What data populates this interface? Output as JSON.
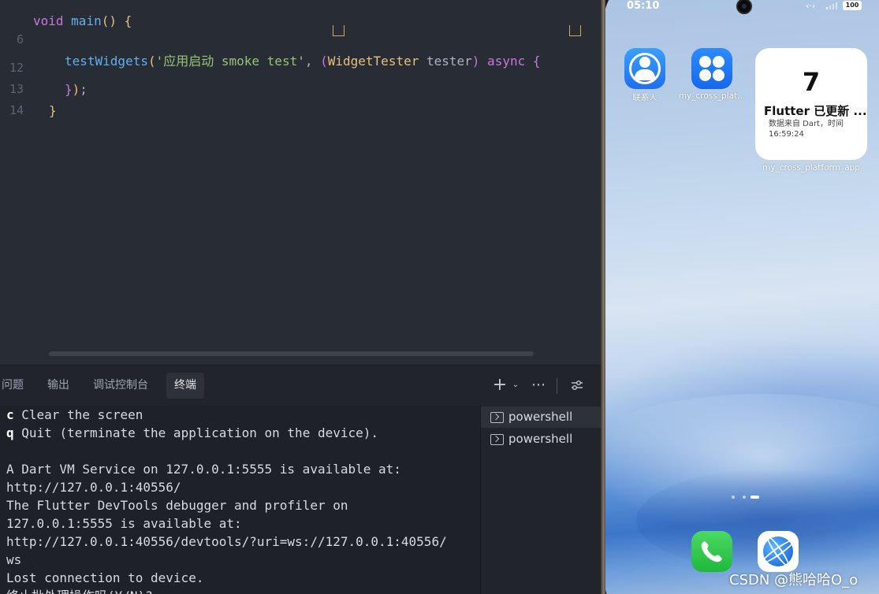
{
  "editor": {
    "line_numbers": [
      "6",
      "12",
      "13",
      "14"
    ],
    "line6": {
      "fn": "testWidgets",
      "open": "(",
      "str": "'应用启动 smoke test'",
      "comma": ", ",
      "paren2": "(",
      "type": "WidgetTester",
      "param": " tester",
      "paren2_close": ")",
      "async": " async",
      "brace": " {"
    },
    "line12": {
      "brace": "}",
      "paren": ")",
      "semi": ";"
    },
    "line13": {
      "brace": "}"
    }
  },
  "panel": {
    "tabs": [
      {
        "label": "问题"
      },
      {
        "label": "输出"
      },
      {
        "label": "调试控制台"
      },
      {
        "label": "终端",
        "active": true
      }
    ],
    "toolbar_icons": [
      "plus-icon",
      "chevron-down-icon",
      "more-icon",
      "settings-sliders-icon"
    ]
  },
  "terminal": {
    "lines": [
      {
        "key": "c",
        "text": " Clear the screen"
      },
      {
        "key": "q",
        "text": " Quit (terminate the application on the device)."
      },
      {
        "key": "",
        "text": ""
      },
      {
        "key": "",
        "text": "A Dart VM Service on 127.0.0.1:5555 is available at:"
      },
      {
        "key": "",
        "text": "http://127.0.0.1:40556/"
      },
      {
        "key": "",
        "text": "The Flutter DevTools debugger and profiler on"
      },
      {
        "key": "",
        "text": "127.0.0.1:5555 is available at:"
      },
      {
        "key": "",
        "text": "http://127.0.0.1:40556/devtools/?uri=ws://127.0.0.1:40556/"
      },
      {
        "key": "",
        "text": "ws"
      },
      {
        "key": "",
        "text": "Lost connection to device."
      },
      {
        "key": "",
        "text": "终止批处理操作吗(Y/N)?"
      }
    ],
    "instances": [
      {
        "label": "powershell",
        "selected": true
      },
      {
        "label": "powershell",
        "selected": false
      }
    ]
  },
  "phone": {
    "time": "05:10",
    "battery": "100",
    "apps": {
      "contacts": "联系人",
      "cross_platform": "my_cross_plat...",
      "widget_app": "my_cross_platform_app"
    },
    "widget": {
      "count": "7",
      "title": "Flutter 已更新 ...",
      "subtitle": "数据来自 Dart，时间 16:59:24"
    }
  },
  "watermark": "CSDN @熊哈哈O_o"
}
